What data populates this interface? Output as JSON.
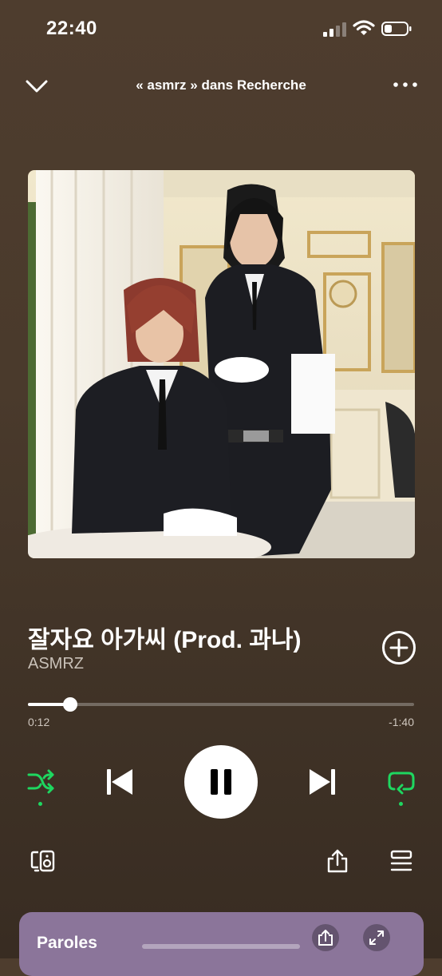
{
  "status_bar": {
    "time": "22:40"
  },
  "header": {
    "context": "« asmrz » dans Recherche"
  },
  "track": {
    "title": "잘자요 아가씨 (Prod. 과나)",
    "artist": "ASMRZ"
  },
  "progress": {
    "elapsed": "0:12",
    "remaining": "-1:40",
    "fraction": 0.11
  },
  "lyrics": {
    "label": "Paroles"
  },
  "colors": {
    "accent": "#1ed760",
    "lyrics_card": "#8b759a",
    "background": "#4a3a2c"
  },
  "icons": [
    "signal-icon",
    "wifi-icon",
    "battery-icon",
    "chevron-down-icon",
    "more-icon",
    "add-icon",
    "shuffle-icon",
    "previous-icon",
    "pause-icon",
    "next-icon",
    "repeat-icon",
    "devices-icon",
    "share-icon",
    "queue-icon",
    "expand-icon"
  ]
}
